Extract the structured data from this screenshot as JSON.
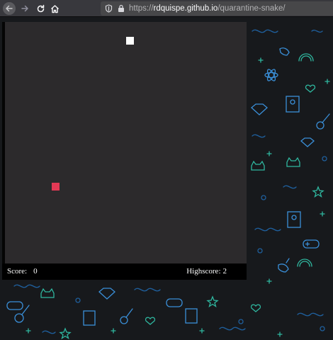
{
  "browser": {
    "url_scheme": "https://",
    "url_host": "rdquispe.github.io",
    "url_path": "/quarantine-snake/",
    "icons": [
      "back-icon",
      "forward-icon",
      "reload-icon",
      "home-icon",
      "shield-icon",
      "lock-icon"
    ]
  },
  "game": {
    "score_label": "Score:",
    "score_value": "0",
    "highscore_label": "Highscore:",
    "highscore_value": "2",
    "canvas_color": "#2c2a2c",
    "food_color": "#fdfdfd",
    "snake_color": "#e33955"
  },
  "background": {
    "doodle_colors": [
      "#3a8fd8",
      "#2fb8a0",
      "#1f5f9c"
    ],
    "doodle_icons": [
      "gamepad-icon",
      "guitar-icon",
      "atom-icon",
      "heart-icon",
      "rainbow-icon",
      "unicorn-icon",
      "cat-icon",
      "diamond-icon",
      "star-icon",
      "photo-frame-icon"
    ]
  }
}
